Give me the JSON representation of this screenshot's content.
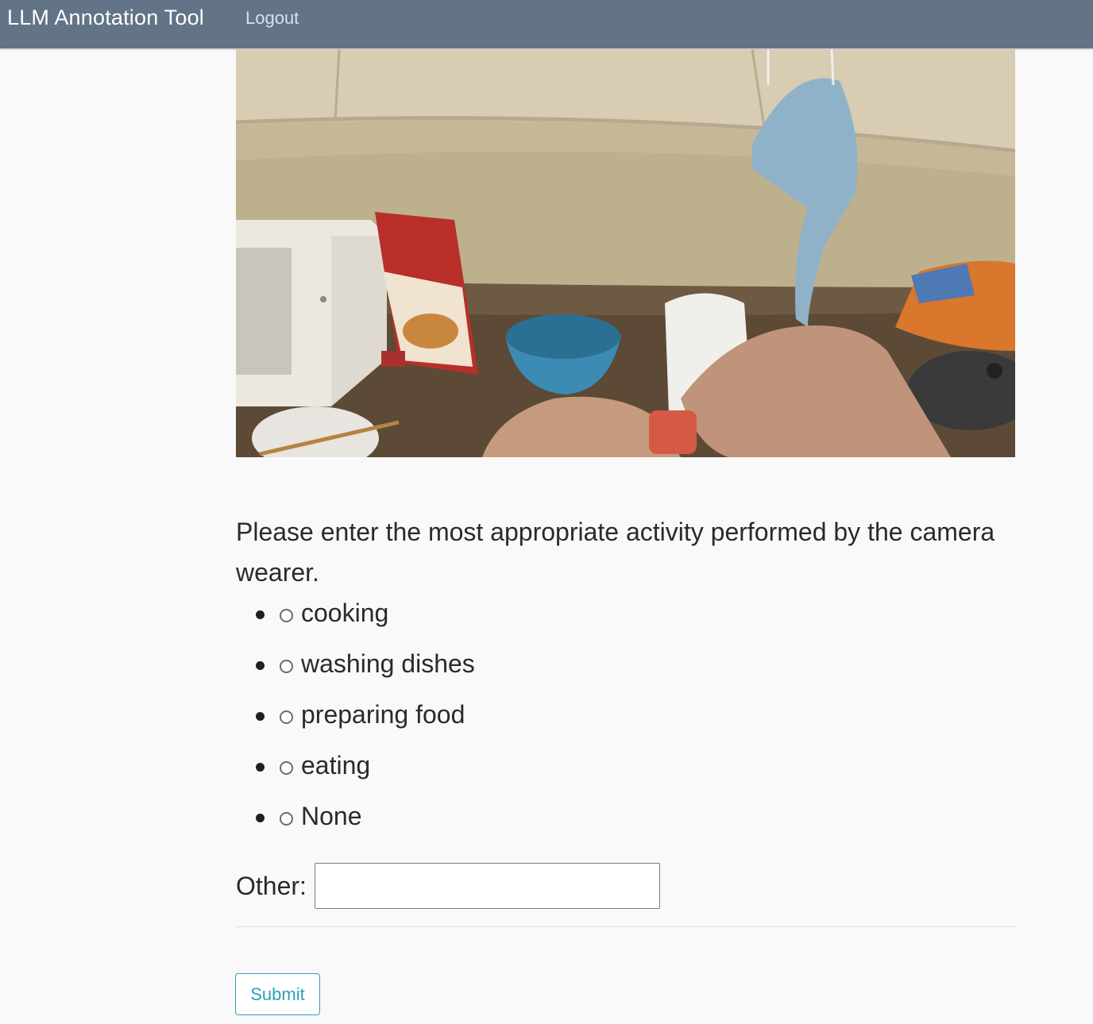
{
  "navbar": {
    "brand": "LLM Annotation Tool",
    "logout": "Logout",
    "color": "#627486"
  },
  "media": {
    "kind": "first-person video frame of a kitchen counter"
  },
  "form": {
    "prompt": "Please enter the most appropriate activity performed by the camera wearer.",
    "options": [
      {
        "label": "cooking",
        "checked": false
      },
      {
        "label": "washing dishes",
        "checked": false
      },
      {
        "label": "preparing food",
        "checked": false
      },
      {
        "label": "eating",
        "checked": false
      },
      {
        "label": "None",
        "checked": false
      }
    ],
    "other_label": "Other:",
    "other_value": "",
    "submit_label": "Submit",
    "accent_color": "#2f9fb6"
  }
}
